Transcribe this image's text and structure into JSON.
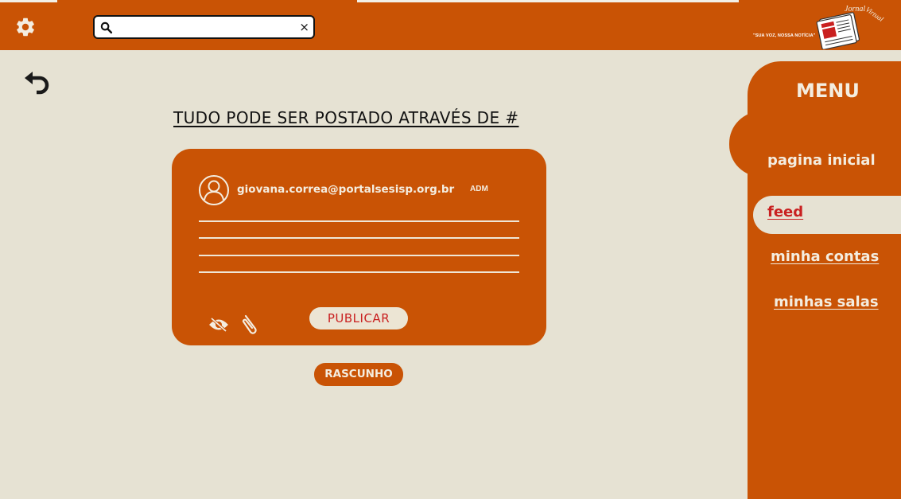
{
  "colors": {
    "primary": "#c95305",
    "background": "#e6e2d3",
    "light_text": "#f4ede0",
    "accent_red": "#c92020"
  },
  "header": {
    "settings_icon": "gear-icon",
    "search": {
      "value": "",
      "placeholder": "",
      "search_icon": "search-icon",
      "clear_icon": "close-icon",
      "clear_label": "×"
    },
    "logo": {
      "name": "Jornal Virtual",
      "slogan": "\"SUA VOZ, NOSSA NOTÍCIA\""
    }
  },
  "back_icon": "back-arrow-icon",
  "main": {
    "heading": "TUDO PODE SER POSTADO ATRAVÉS DE #",
    "post_card": {
      "user_icon": "user-icon",
      "email": "giovana.correa@portalsesisp.org.br",
      "role": "ADM",
      "visibility_icon": "eye-off-icon",
      "attach_icon": "paperclip-icon",
      "publish_label": "PUBLICAR"
    },
    "draft_label": "RASCUNHO"
  },
  "sidebar": {
    "title": "MENU",
    "items": [
      {
        "label": "pagina inicial",
        "active": false
      },
      {
        "label": "feed",
        "active": true
      },
      {
        "label": "minha contas",
        "active": false
      },
      {
        "label": "minhas salas",
        "active": false
      }
    ]
  }
}
